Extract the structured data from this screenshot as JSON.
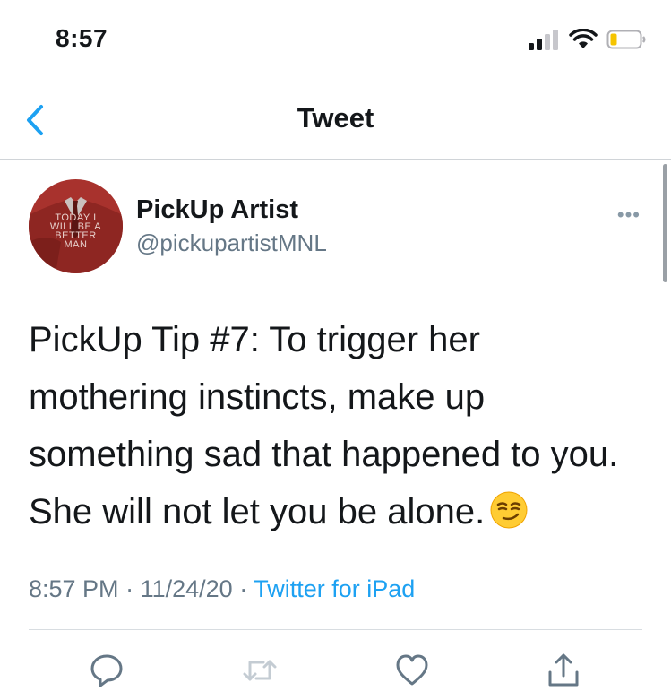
{
  "status_bar": {
    "time": "8:57",
    "icons": [
      "signal-bars-icon",
      "wifi-icon",
      "battery-low-icon"
    ]
  },
  "nav": {
    "title": "Tweet",
    "back_icon": "chevron-left-icon"
  },
  "tweet": {
    "author_name": "PickUp Artist",
    "author_handle": "@pickupartistMNL",
    "avatar_text": [
      "TODAY I",
      "WILL BE A",
      "BETTER",
      "MAN"
    ],
    "text": "PickUp Tip #7: To trigger her mothering instincts, make up something sad that happened to you. She will not let you be alone.",
    "emoji": "smirking-face-icon",
    "time": "8:57 PM",
    "date": "11/24/20",
    "separator": "·",
    "source": "Twitter for iPad",
    "more_label": "•••"
  },
  "actions": [
    "reply-icon",
    "retweet-icon",
    "like-icon",
    "share-icon"
  ],
  "colors": {
    "accent": "#1da1f2",
    "secondary_text": "#657786",
    "avatar_bg": "#a8322d",
    "battery_low": "#f5c400"
  }
}
